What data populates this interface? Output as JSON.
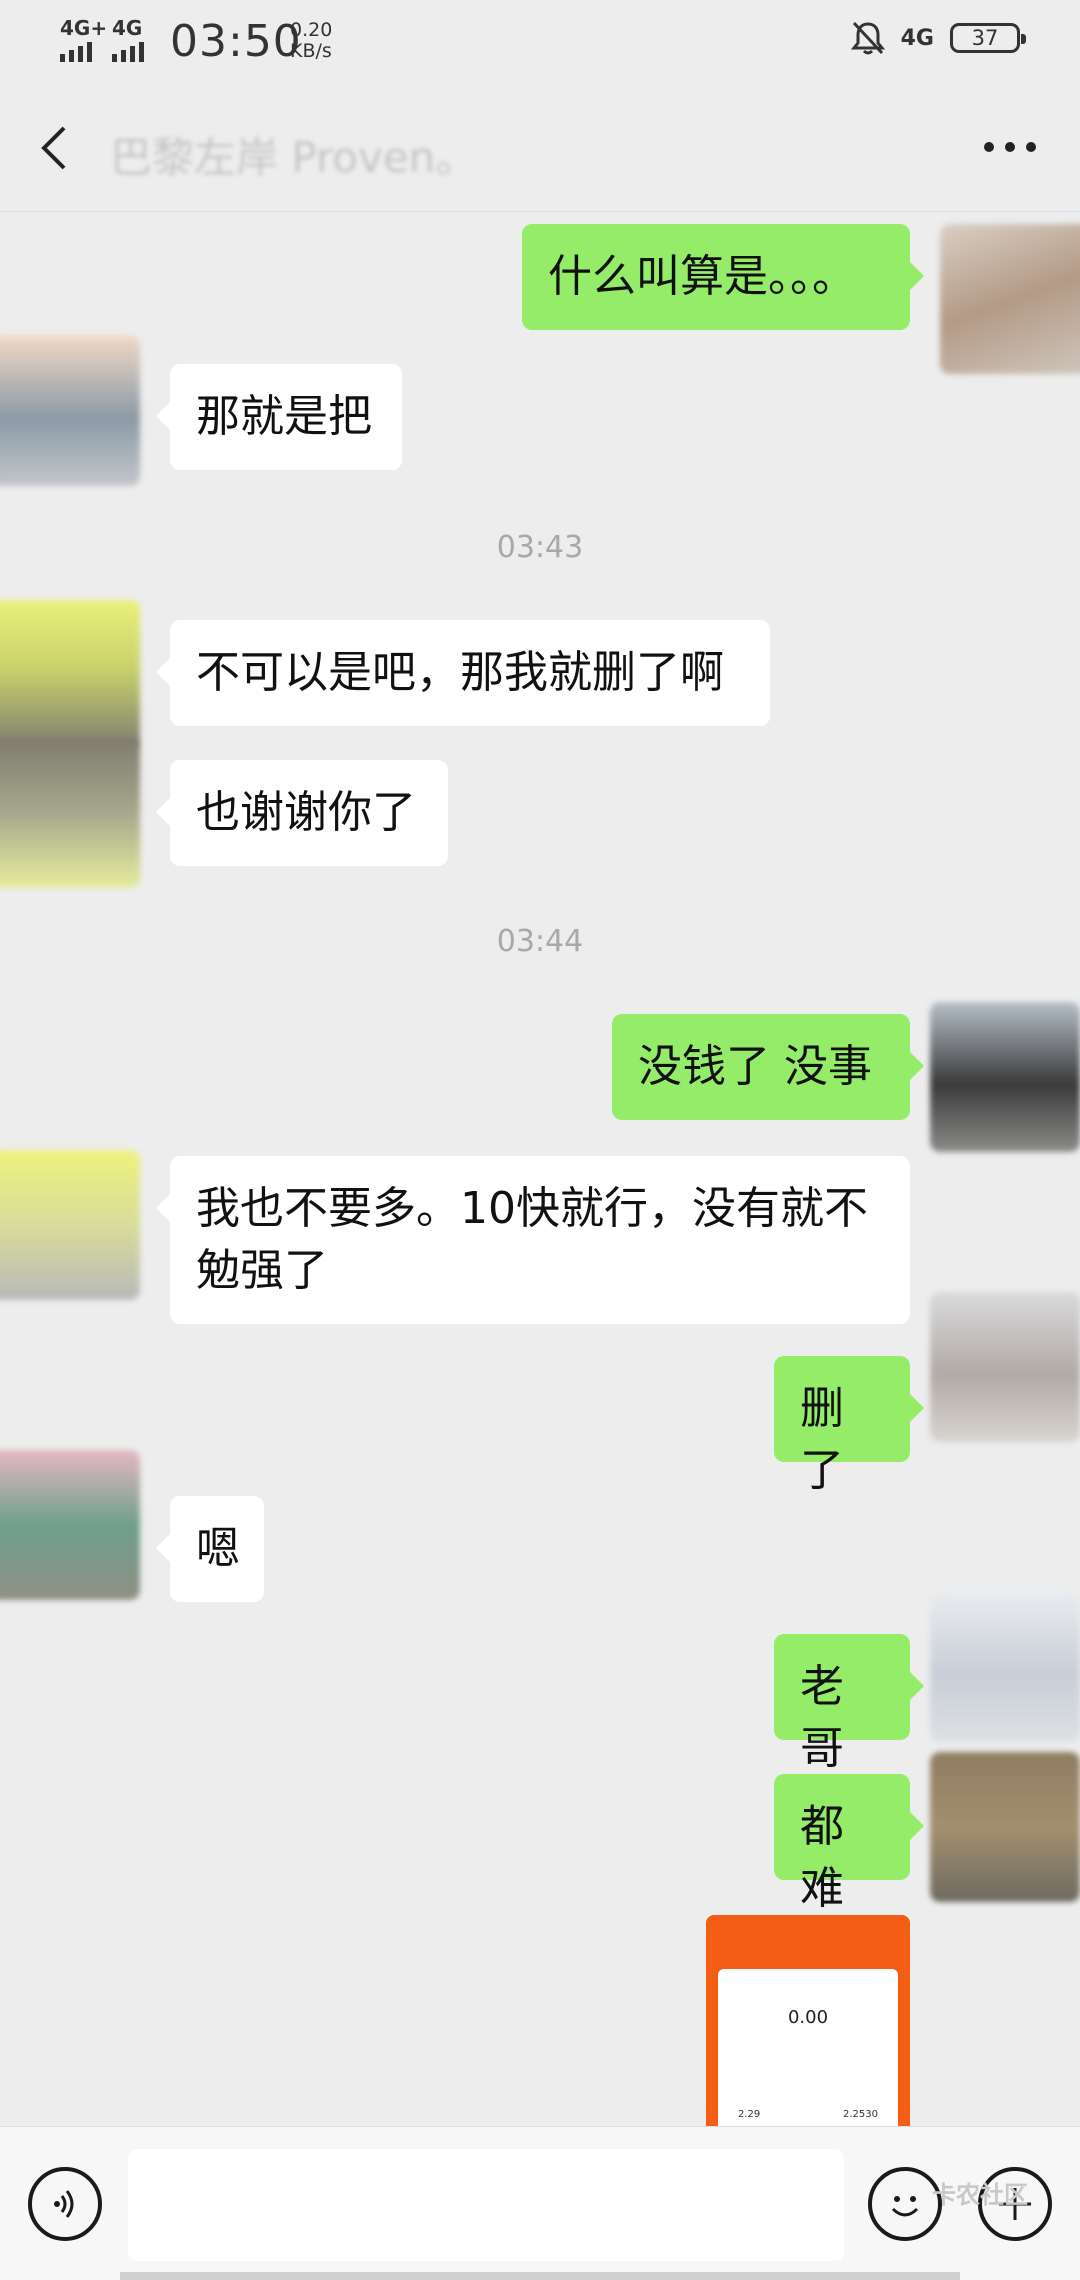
{
  "status_bar": {
    "network1": "4G+",
    "network2": "4G",
    "time": "03:50",
    "speed_value": "0.20",
    "speed_unit": "KB/s",
    "network_right": "4G",
    "battery": "37"
  },
  "header": {
    "title": "巴黎左岸 Proven。"
  },
  "messages": [
    {
      "side": "right",
      "text": "什么叫算是。。。"
    },
    {
      "side": "left",
      "text": "那就是把"
    },
    {
      "time": "03:43"
    },
    {
      "side": "left",
      "text": "不可以是吧，那我就删了啊"
    },
    {
      "side": "left",
      "text": "也谢谢你了"
    },
    {
      "time": "03:44"
    },
    {
      "side": "right",
      "text": "没钱了  没事"
    },
    {
      "side": "left",
      "text": "我也不要多。10快就行，没有就不勉强了"
    },
    {
      "side": "right",
      "text": "删了"
    },
    {
      "side": "left",
      "text": "嗯"
    },
    {
      "side": "right",
      "text": "老哥"
    },
    {
      "side": "right",
      "text": "都难"
    }
  ],
  "thumbnail": {
    "amount": "0.00",
    "value_a": "2.29",
    "value_b": "2.2530"
  },
  "watermark": {
    "text": "卡农社区"
  },
  "colors": {
    "background": "#ededed",
    "bubble_self": "#95ec69",
    "bubble_other": "#ffffff",
    "thumb_accent": "#f35d14"
  }
}
